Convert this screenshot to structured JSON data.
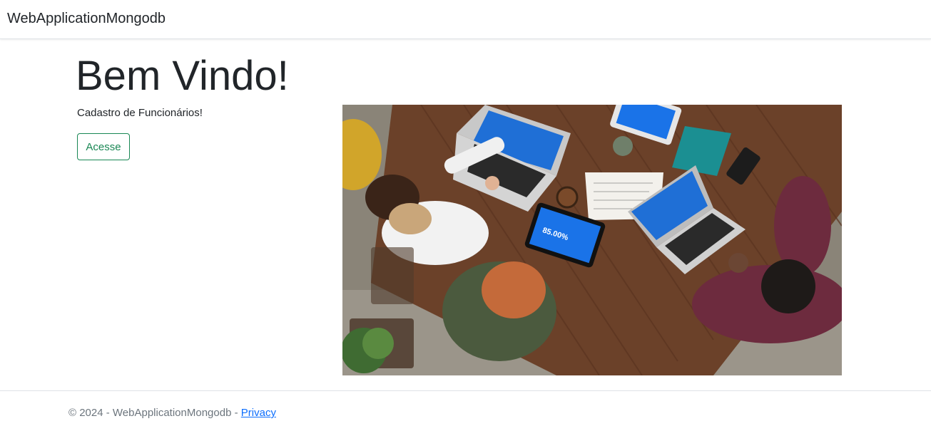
{
  "navbar": {
    "brand": "WebApplicationMongodb"
  },
  "main": {
    "title": "Bem Vindo!",
    "subtitle": "Cadastro de Funcionários!",
    "button_label": "Acesse",
    "image_tablet_text": "85.00%"
  },
  "footer": {
    "text": "© 2024 - WebApplicationMongodb - ",
    "privacy_label": "Privacy"
  },
  "colors": {
    "accent_green": "#198754",
    "link_blue": "#0d6efd",
    "muted": "#6c757d"
  }
}
